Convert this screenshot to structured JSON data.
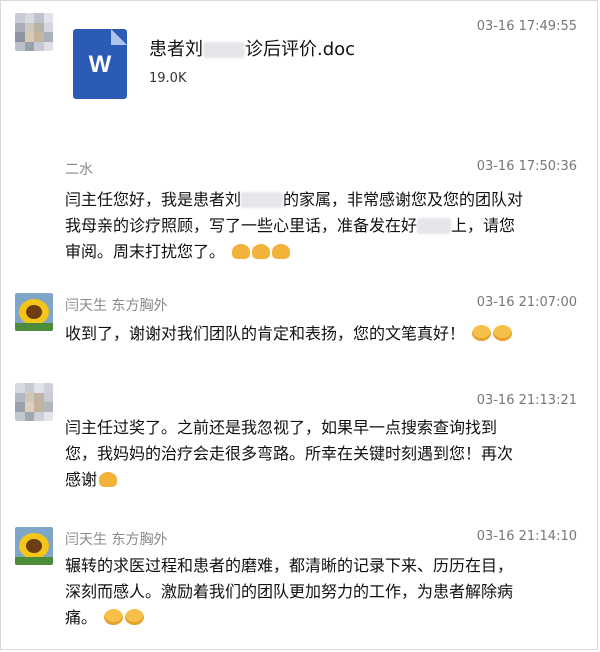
{
  "messages": [
    {
      "type": "file",
      "name": "",
      "time": "03-16 17:49:55",
      "file": {
        "icon": "word-doc-icon",
        "letter": "W",
        "name_prefix": "患者刘",
        "name_suffix": "诊后评价.doc",
        "size": "19.0K"
      }
    },
    {
      "type": "text",
      "name": "二水",
      "time": "03-16 17:50:36",
      "lines": [
        "闫主任您好，我是患者刘",
        "的家属，非常感谢您及您的团队对",
        "我母亲的诊疗照顾，写了一些心里话，准备发在好",
        "上，请您",
        "审阅。周末打扰您了。"
      ]
    },
    {
      "type": "text",
      "name": "闫天生 东方胸外",
      "time": "03-16 21:07:00",
      "lines": [
        "收到了，谢谢对我们团队的肯定和表扬，您的文笔真好！"
      ]
    },
    {
      "type": "text",
      "name": "",
      "time": "03-16 21:13:21",
      "lines": [
        "闫主任过奖了。之前还是我忽视了，如果早一点搜索查询找到",
        "您，我妈妈的治疗会走很多弯路。所幸在关键时刻遇到您！再次",
        "感谢"
      ]
    },
    {
      "type": "text",
      "name": "闫天生 东方胸外",
      "time": "03-16 21:14:10",
      "lines": [
        "辗转的求医过程和患者的磨难，都清晰的记录下来、历历在目，",
        "深刻而感人。激励着我们的团队更加努力的工作，为患者解除病",
        "痛。"
      ]
    }
  ],
  "colors": {
    "word_blue": "#2b5bb5",
    "text": "#111111",
    "meta": "#8a8a8a"
  }
}
